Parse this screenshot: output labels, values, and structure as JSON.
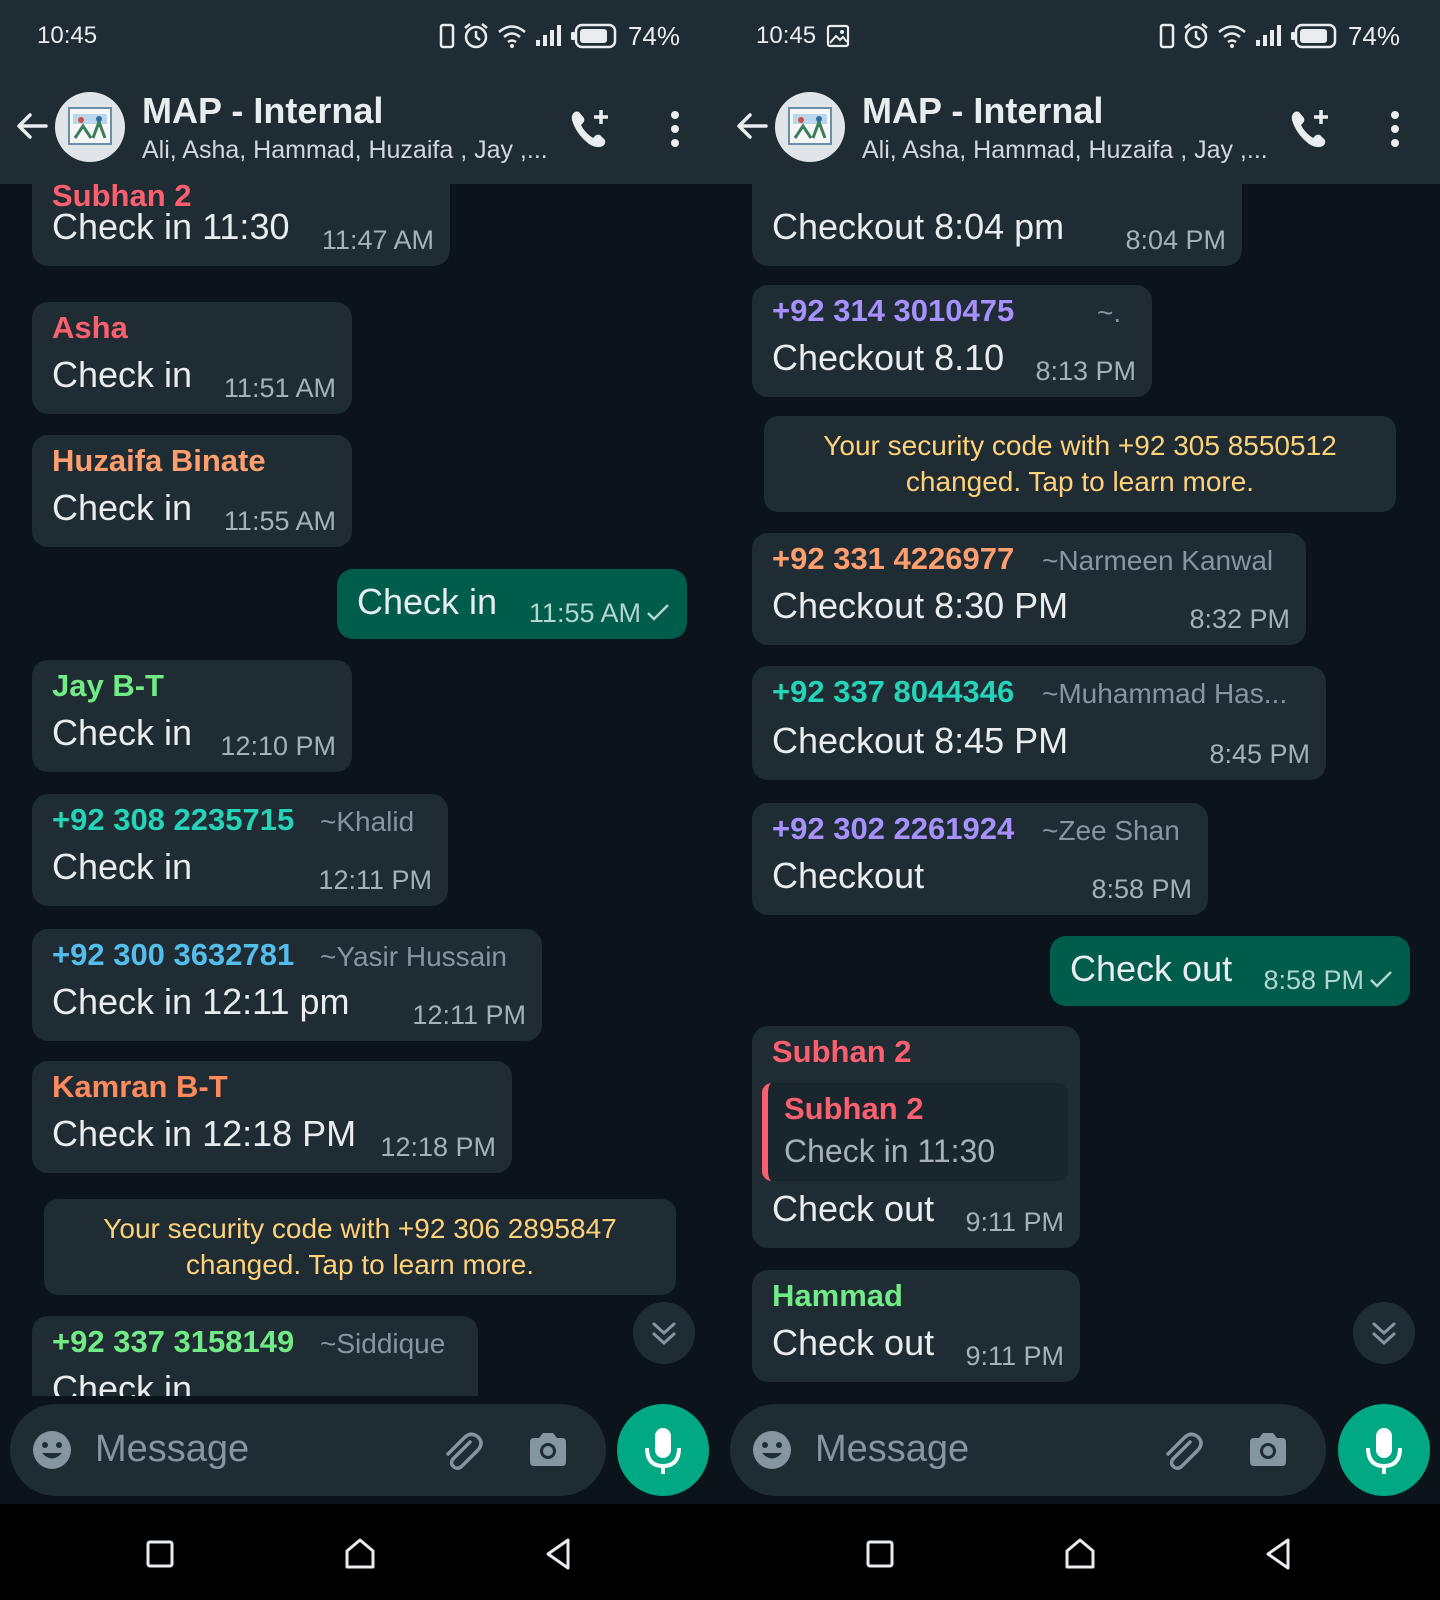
{
  "status": {
    "time": "10:45",
    "battery": "74%"
  },
  "header": {
    "title": "MAP - Internal",
    "subtitle": "Ali, Asha, Hammad, Huzaifa , Jay ,..."
  },
  "left": {
    "messages": [
      {
        "sender": "Subhan 2",
        "text": "Check in 11:30",
        "time": "11:47 AM",
        "color": "#fc5f6e"
      },
      {
        "sender": "Asha",
        "text": "Check in",
        "time": "11:51 AM",
        "color": "#fc5f6e"
      },
      {
        "sender": "Huzaifa Binate",
        "text": "Check in",
        "time": "11:55 AM",
        "color": "#ff9f6e"
      },
      {
        "text": "Check in",
        "time": "11:55 AM",
        "outgoing": true
      },
      {
        "sender": "Jay B-T",
        "text": "Check in",
        "time": "12:10 PM",
        "color": "#71eb85"
      },
      {
        "sender": "+92 308 2235715",
        "pushname": "~Khalid",
        "text": "Check in",
        "time": "12:11 PM",
        "color": "#25d3b8"
      },
      {
        "sender": "+92 300 3632781",
        "pushname": "~Yasir Hussain",
        "text": "Check in 12:11 pm",
        "time": "12:11 PM",
        "color": "#53bdeb"
      },
      {
        "sender": "Kamran B-T",
        "text": "Check in 12:18 PM",
        "time": "12:18 PM",
        "color": "#ff8a5b"
      },
      {
        "sender": "+92 337 3158149",
        "pushname": "~Siddique",
        "text": "Check in",
        "color": "#71eb85"
      }
    ],
    "system": "Your security code with +92 306 2895847 changed. Tap to learn more."
  },
  "right": {
    "messages": [
      {
        "text": "Checkout 8:04 pm",
        "time": "8:04 PM"
      },
      {
        "sender": "+92 314 3010475",
        "pushname": "~.",
        "text": "Checkout 8.10",
        "time": "8:13 PM",
        "color": "#a791ff"
      },
      {
        "sender": "+92 331 4226977",
        "pushname": "~Narmeen Kanwal",
        "text": "Checkout 8:30 PM",
        "time": "8:32 PM",
        "color": "#ff9f6e"
      },
      {
        "sender": "+92 337 8044346",
        "pushname": "~Muhammad Has...",
        "text": "Checkout 8:45 PM",
        "time": "8:45 PM",
        "color": "#25d3b8"
      },
      {
        "sender": "+92 302 2261924",
        "pushname": "~Zee Shan",
        "text": "Checkout",
        "time": "8:58 PM",
        "color": "#a791ff"
      },
      {
        "text": "Check out",
        "time": "8:58 PM",
        "outgoing": true
      },
      {
        "sender": "Subhan 2",
        "quote_sender": "Subhan 2",
        "quote_text": "Check in 11:30",
        "text": "Check out",
        "time": "9:11 PM",
        "color": "#fc5f6e"
      },
      {
        "sender": "Hammad",
        "text": "Check out",
        "time": "9:11 PM",
        "color": "#71eb85"
      }
    ],
    "system": "Your security code with +92 305 8550512 changed. Tap to learn more."
  },
  "input": {
    "placeholder": "Message"
  },
  "icons": {
    "back": "arrow-left-icon",
    "call": "add-call-icon",
    "menu": "kebab-menu-icon",
    "emoji": "emoji-icon",
    "attach": "paperclip-icon",
    "camera": "camera-icon",
    "mic": "mic-icon",
    "scroll": "double-chevron-down-icon",
    "read": "check-icon",
    "nav_recent": "square-icon",
    "nav_home": "home-icon",
    "nav_back": "triangle-back-icon"
  },
  "colors": {
    "background": "#0b141a",
    "bar": "#1f2c34",
    "bubble_in": "#1f2c34",
    "bubble_out": "#005c4b",
    "accent": "#00a884",
    "system_text": "#ffd279"
  }
}
